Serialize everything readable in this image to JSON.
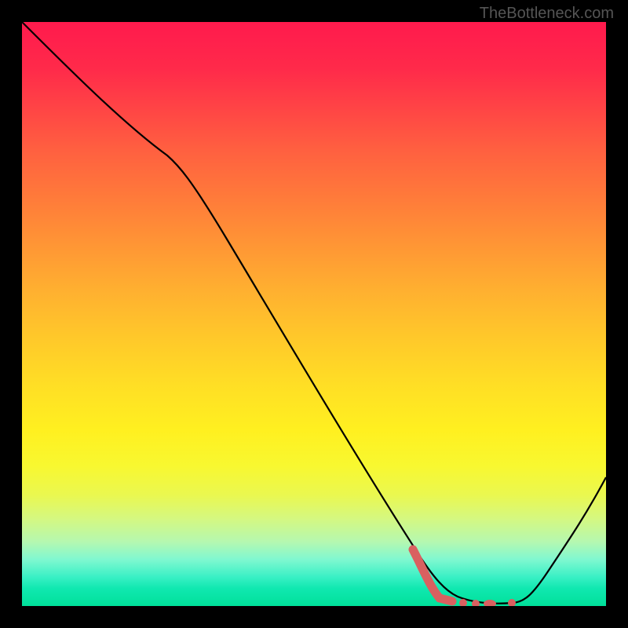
{
  "watermark": "TheBottleneck.com",
  "chart_data": {
    "type": "line",
    "title": "",
    "xlabel": "",
    "ylabel": "",
    "xlim": [
      0,
      100
    ],
    "ylim": [
      0,
      100
    ],
    "series": [
      {
        "name": "bottleneck-curve",
        "color": "#000000",
        "x": [
          0,
          25,
          30,
          70,
          75,
          80,
          85,
          100
        ],
        "y": [
          100,
          78,
          74,
          12,
          3,
          1,
          0,
          22
        ]
      },
      {
        "name": "optimal-region",
        "style": "dotted",
        "color": "#d96060",
        "x": [
          70,
          74,
          78,
          82,
          85
        ],
        "y": [
          8,
          2,
          1,
          0.5,
          0.5
        ]
      }
    ],
    "annotations": []
  },
  "colors": {
    "gradient_top": "#ff1a4d",
    "gradient_mid": "#ffde25",
    "gradient_bottom": "#00e09a",
    "curve": "#000000",
    "dotted": "#d96060",
    "background": "#000000"
  }
}
